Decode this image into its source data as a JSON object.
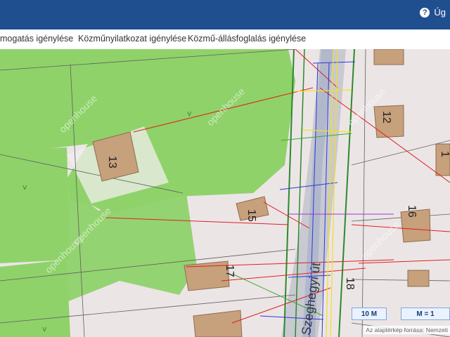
{
  "header": {
    "help_label": "Úg"
  },
  "tabs": [
    {
      "label": "mogatás igénylése"
    },
    {
      "label": "Közműnyilatkozat igénylése"
    },
    {
      "label": "Közmű-állásfoglalás igénylése"
    }
  ],
  "map": {
    "building_numbers": [
      "13",
      "15",
      "17",
      "12",
      "16",
      "18",
      "1"
    ],
    "street_name": "Szeghegyi út",
    "watermark": "openhouse",
    "scale_bar": "10 M",
    "ratio": "M = 1",
    "attribution": "Az alaptérkép forrása: Nemzeti"
  },
  "colors": {
    "header_bg": "#1f4f8f",
    "green_area": "#8fd26a",
    "accent": "#3f7fd2"
  }
}
